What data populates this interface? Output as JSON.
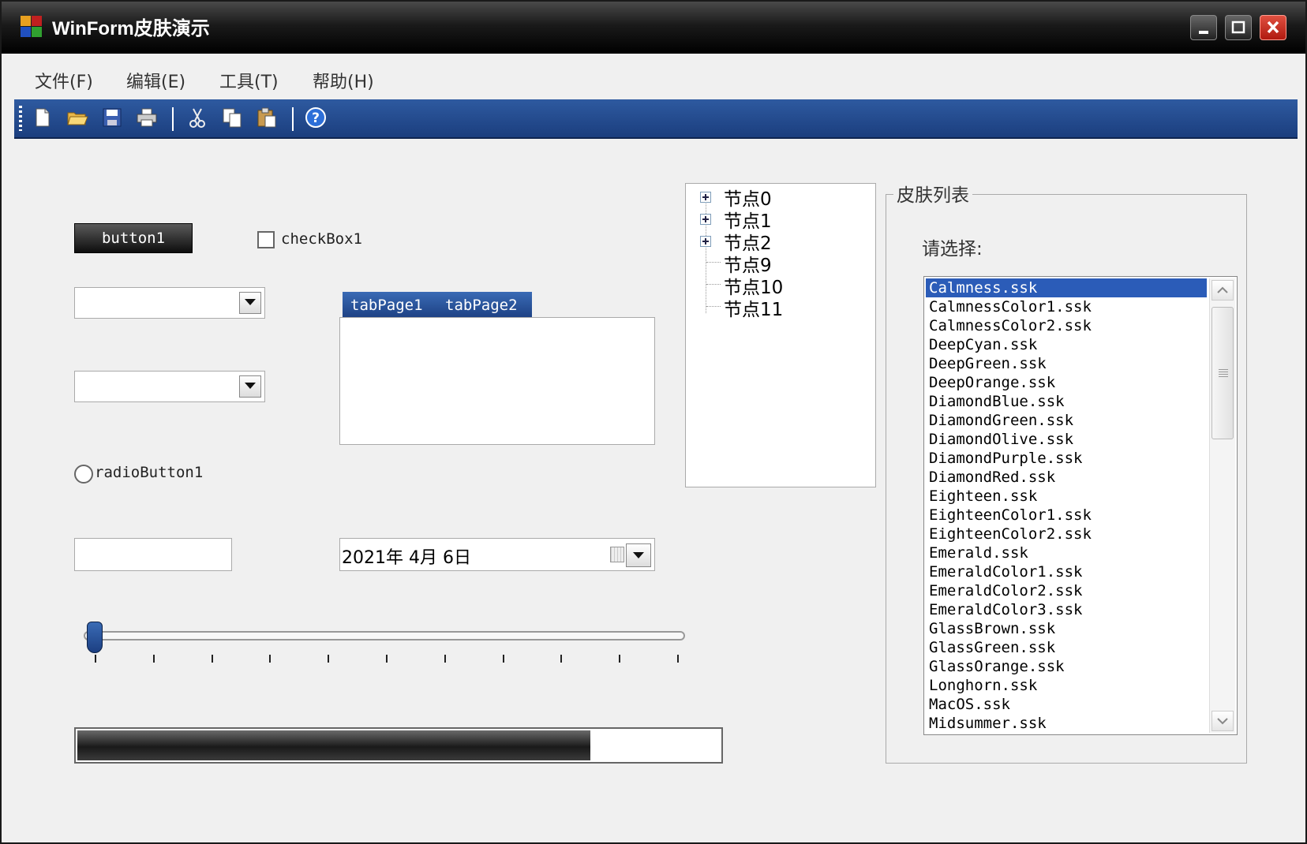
{
  "window": {
    "title": "WinForm皮肤演示"
  },
  "menu": {
    "items": [
      "文件(F)",
      "编辑(E)",
      "工具(T)",
      "帮助(H)"
    ]
  },
  "toolbar": {
    "icons": [
      "new-document-icon",
      "open-folder-icon",
      "save-icon",
      "print-icon",
      "cut-icon",
      "copy-icon",
      "paste-icon",
      "help-icon"
    ]
  },
  "controls": {
    "button1": "button1",
    "checkbox1": "checkBox1",
    "radio1": "radioButton1",
    "combo1_value": "",
    "combo2_value": "",
    "textbox_value": "",
    "tabs": [
      "tabPage1",
      "tabPage2"
    ],
    "date_value": "2021年 4月 6日",
    "trackbar": {
      "min": 0,
      "max": 10,
      "value": 0
    },
    "progress_percent": 80
  },
  "tree": {
    "nodes": [
      {
        "label": "节点0",
        "expandable": true
      },
      {
        "label": "节点1",
        "expandable": true
      },
      {
        "label": "节点2",
        "expandable": true
      },
      {
        "label": "节点9",
        "expandable": false
      },
      {
        "label": "节点10",
        "expandable": false
      },
      {
        "label": "节点11",
        "expandable": false
      }
    ]
  },
  "skins": {
    "group_title": "皮肤列表",
    "prompt": "请选择:",
    "selected": "Calmness.ssk",
    "items": [
      "Calmness.ssk",
      "CalmnessColor1.ssk",
      "CalmnessColor2.ssk",
      "DeepCyan.ssk",
      "DeepGreen.ssk",
      "DeepOrange.ssk",
      "DiamondBlue.ssk",
      "DiamondGreen.ssk",
      "DiamondOlive.ssk",
      "DiamondPurple.ssk",
      "DiamondRed.ssk",
      "Eighteen.ssk",
      "EighteenColor1.ssk",
      "EighteenColor2.ssk",
      "Emerald.ssk",
      "EmeraldColor1.ssk",
      "EmeraldColor2.ssk",
      "EmeraldColor3.ssk",
      "GlassBrown.ssk",
      "GlassGreen.ssk",
      "GlassOrange.ssk",
      "Longhorn.ssk",
      "MacOS.ssk",
      "Midsummer.ssk"
    ]
  },
  "colors": {
    "accent": "#2b5cb8",
    "toolbar": "#1f4488",
    "titlebar": "#111111"
  }
}
